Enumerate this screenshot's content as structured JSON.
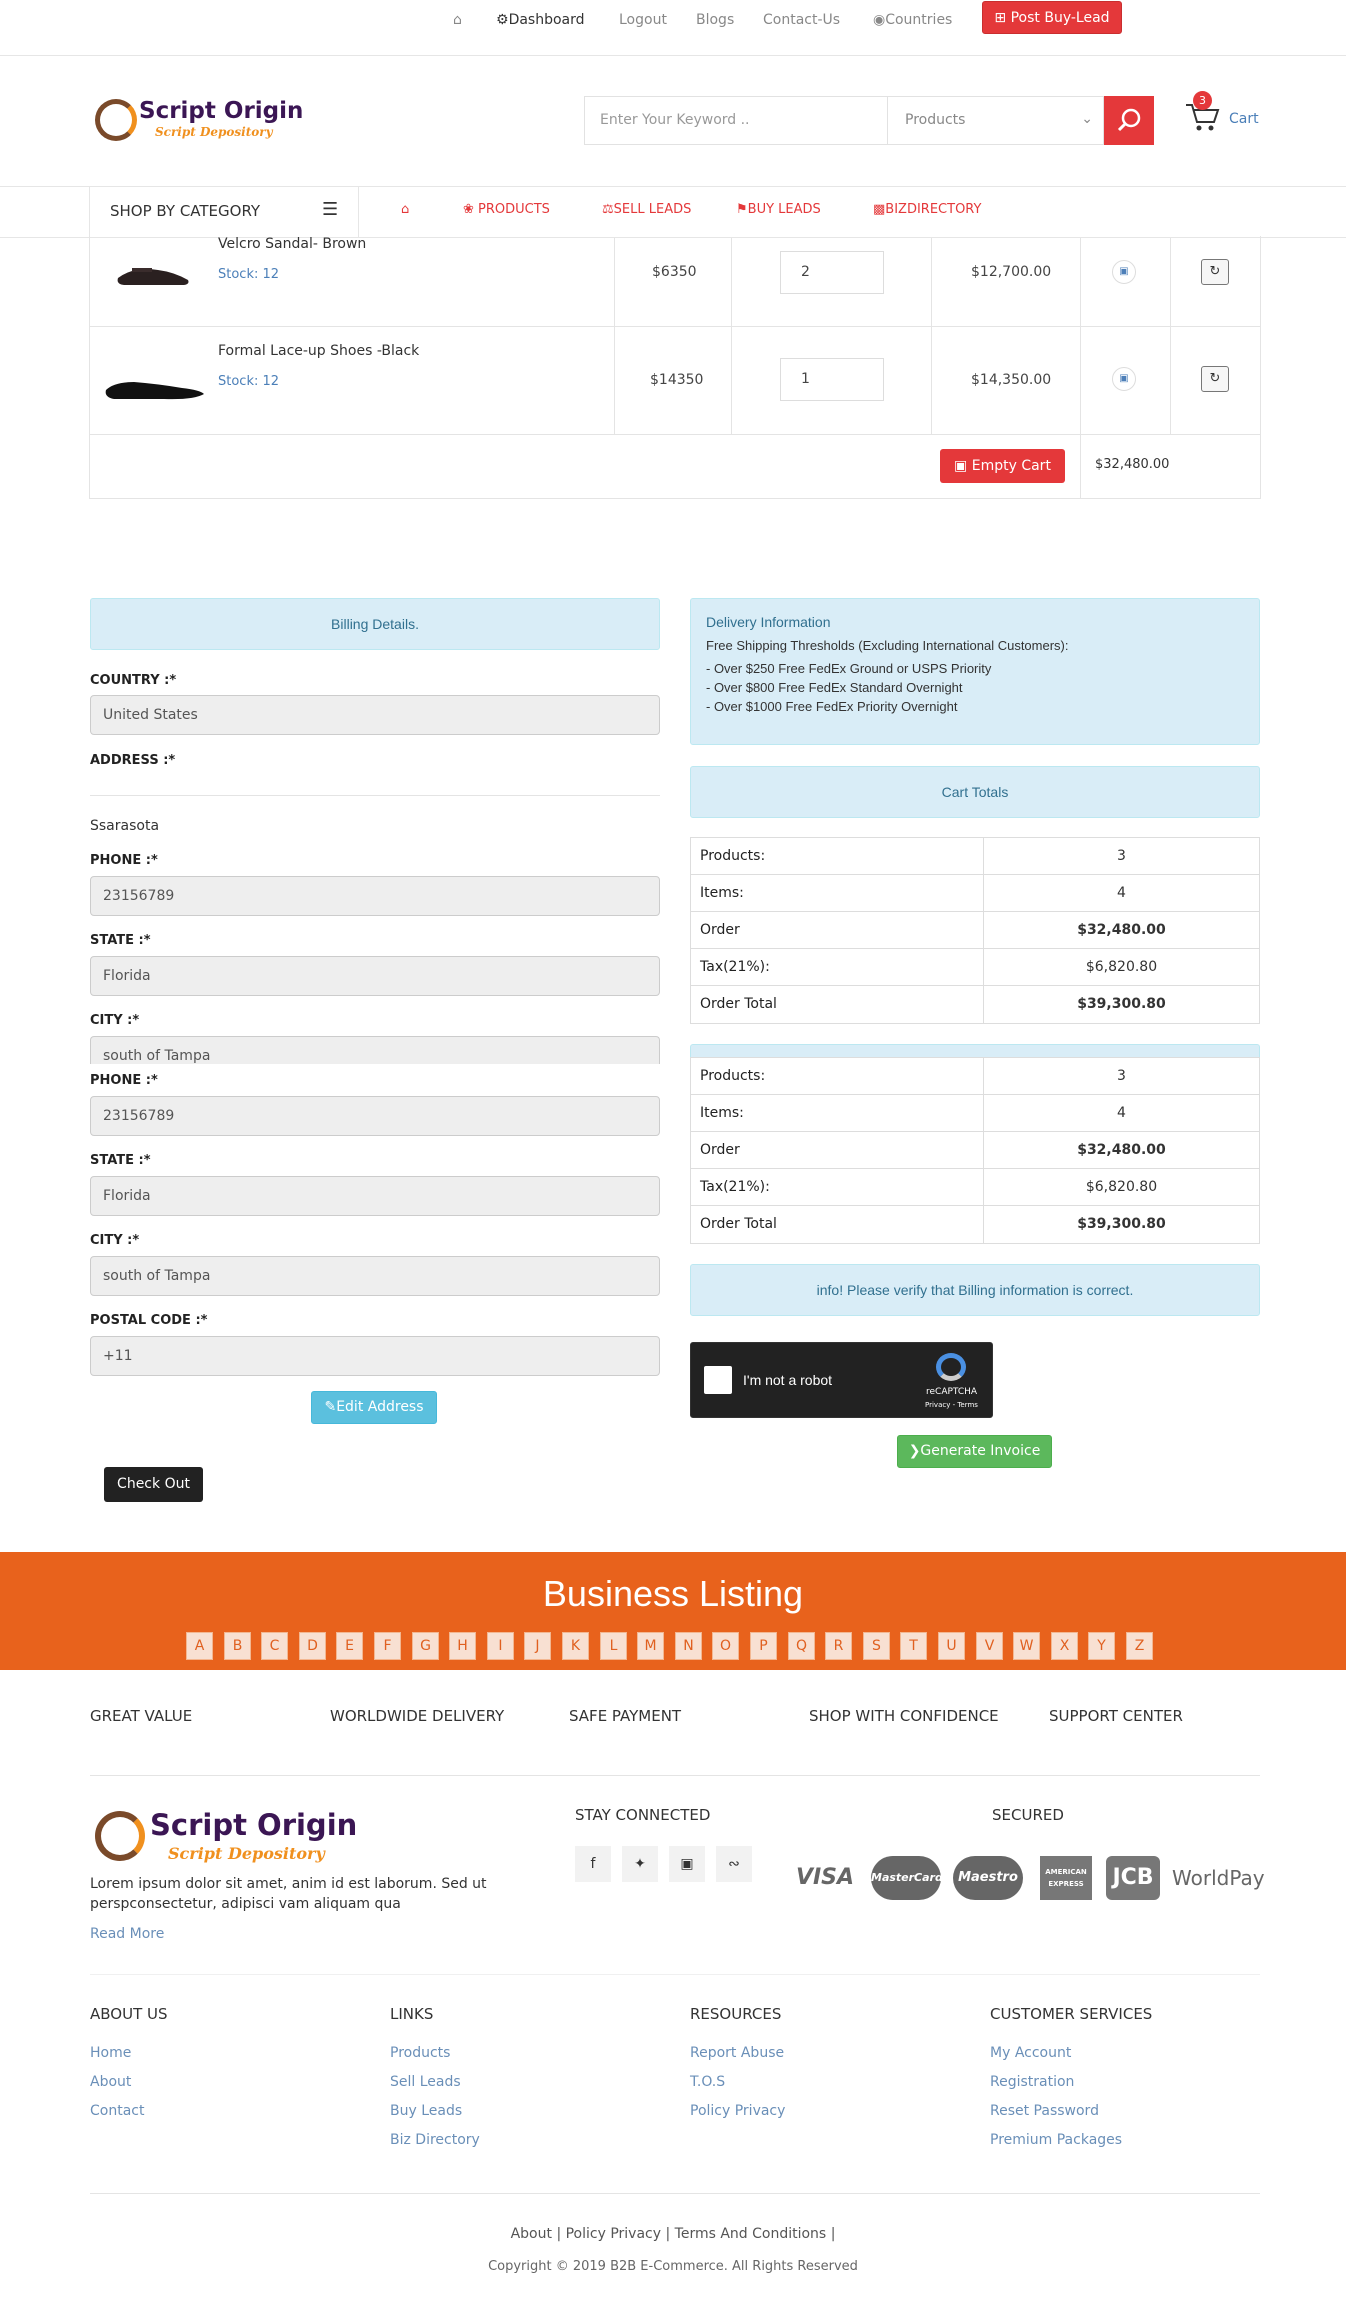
{
  "topnav": {
    "home_icon": "home-icon",
    "dashboard": "Dashboard",
    "logout": "Logout",
    "blogs": "Blogs",
    "contact": "Contact-Us",
    "countries": "Countries",
    "post_buy_lead": "Post Buy-Lead"
  },
  "brand": {
    "name": "Script Origin",
    "tagline": "Script Depository"
  },
  "search": {
    "placeholder": "Enter Your Keyword ..",
    "category": "Products"
  },
  "cart": {
    "count": "3",
    "label": "Cart"
  },
  "categories": {
    "shop_by": "SHOP BY CATEGORY",
    "items": [
      "PRODUCTS",
      "SELL LEADS",
      "BUY LEADS",
      "BIZDIRECTORY"
    ]
  },
  "cart_rows": [
    {
      "name": "Velcro Sandal- Brown",
      "stock": "Stock: 12",
      "price": "$6350",
      "qty": "2",
      "subtotal": "$12,700.00"
    },
    {
      "name": "Formal Lace-up Shoes -Black",
      "stock": "Stock: 12",
      "price": "$14350",
      "qty": "1",
      "subtotal": "$14,350.00"
    }
  ],
  "empty_cart": "Empty Cart",
  "cart_total": "$32,480.00",
  "billing": {
    "title": "Billing Details.",
    "country_label": "COUNTRY :*",
    "country": "United States",
    "address_label": "ADDRESS :*",
    "address": "Ssarasota",
    "phone_label": "PHONE :*",
    "phone": "23156789",
    "state_label": "STATE :*",
    "state": "Florida",
    "city_label": "CITY :*",
    "city": "south of Tampa",
    "postal_label": "POSTAL CODE :*",
    "postal": "+11",
    "edit_address": "Edit Address",
    "checkout": "Check Out"
  },
  "delivery": {
    "title": "Delivery Information",
    "threshold": "Free Shipping Thresholds (Excluding International Customers):",
    "lines": [
      "- Over $250 Free FedEx Ground or USPS Priority",
      "- Over $800 Free FedEx Standard Overnight",
      "- Over $1000 Free FedEx Priority Overnight"
    ]
  },
  "cart_totals": {
    "title": "Cart Totals",
    "rows": [
      {
        "label": "Products:",
        "value": "3"
      },
      {
        "label": "Items:",
        "value": "4"
      },
      {
        "label": "Order",
        "value": "$32,480.00"
      },
      {
        "label": "Tax(21%):",
        "value": "$6,820.80"
      },
      {
        "label": "Order Total",
        "value": "$39,300.80"
      }
    ]
  },
  "verify_info": "info! Please verify that Billing information is correct.",
  "recaptcha": {
    "label": "I'm not a robot",
    "brand": "reCAPTCHA",
    "terms": "Privacy - Terms"
  },
  "generate_invoice": "Generate Invoice",
  "business_listing": {
    "title": "Business Listing",
    "letters": [
      "A",
      "B",
      "C",
      "D",
      "E",
      "F",
      "G",
      "H",
      "I",
      "J",
      "K",
      "L",
      "M",
      "N",
      "O",
      "P",
      "Q",
      "R",
      "S",
      "T",
      "U",
      "V",
      "W",
      "X",
      "Y",
      "Z"
    ]
  },
  "features": [
    "GREAT VALUE",
    "WORLDWIDE DELIVERY",
    "SAFE PAYMENT",
    "SHOP WITH CONFIDENCE",
    "SUPPORT CENTER"
  ],
  "footer": {
    "about_text_1": "Lorem ipsum dolor sit amet, anim id est laborum. Sed ut",
    "about_text_2": "perspconsectetur, adipisci vam aliquam qua",
    "read_more": "Read More",
    "stay_connected": "STAY CONNECTED",
    "secured": "SECURED",
    "cards": [
      "VISA",
      "MasterCard",
      "Maestro",
      "AMERICAN EXPRESS",
      "JCB",
      "WorldPay"
    ],
    "columns": [
      {
        "title": "ABOUT US",
        "links": [
          "Home",
          "About",
          "Contact"
        ]
      },
      {
        "title": "LINKS",
        "links": [
          "Products",
          "Sell Leads",
          "Buy Leads",
          "Biz Directory"
        ]
      },
      {
        "title": "RESOURCES",
        "links": [
          "Report Abuse",
          "T.O.S",
          "Policy Privacy"
        ]
      },
      {
        "title": "CUSTOMER SERVICES",
        "links": [
          "My Account",
          "Registration",
          "Reset Password",
          "Premium Packages"
        ]
      }
    ],
    "bottom_links": [
      "About",
      "Policy Privacy",
      "Terms And Conditions"
    ],
    "copyright": "Copyright © 2019 B2B E-Commerce. All Rights Reserved"
  },
  "colors": {
    "accent_red": "#e4383a",
    "orange": "#e8621c",
    "info_bg": "#d9edf7",
    "link_blue": "#6a8fb8",
    "green": "#5cb85c"
  }
}
